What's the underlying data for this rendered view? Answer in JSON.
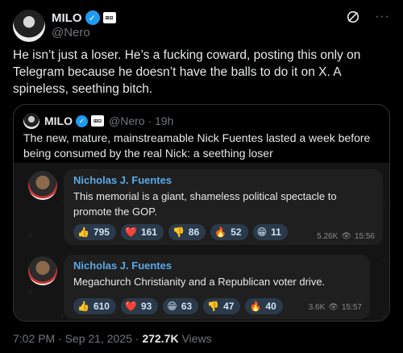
{
  "tweet": {
    "author_name": "MILO",
    "handle": "@Nero",
    "affiliate_badge": "⊞⊟",
    "text": "He isn’t just a loser. He’s a fucking coward, posting this only on Telegram because he doesn’t have the balls to do it on X. A spineless, seething bitch.",
    "timestamp": "7:02 PM · Sep 21, 2025 ·",
    "views_count": "272.7K",
    "views_label": "Views"
  },
  "quote": {
    "author_name": "MILO",
    "handle_time": "@Nero · 19h",
    "text": "The new, mature, mainstreamable Nick Fuentes lasted a week before being consumed by the real Nick: a seething loser"
  },
  "telegram": {
    "messages": [
      {
        "author": "Nicholas J. Fuentes",
        "text": "This memorial is a giant, shameless political spectacle to promote the GOP.",
        "reactions": [
          {
            "emoji": "👍",
            "count": "795"
          },
          {
            "emoji": "❤️",
            "count": "161"
          },
          {
            "emoji": "👎",
            "count": "86"
          },
          {
            "emoji": "🔥",
            "count": "52"
          },
          {
            "emoji": "😁",
            "count": "11"
          }
        ],
        "views": "5.26K",
        "time": "15:56"
      },
      {
        "author": "Nicholas J. Fuentes",
        "text": "Megachurch Christianity and a Republican voter drive.",
        "reactions": [
          {
            "emoji": "👍",
            "count": "610"
          },
          {
            "emoji": "❤️",
            "count": "93"
          },
          {
            "emoji": "😁",
            "count": "63"
          },
          {
            "emoji": "👎",
            "count": "47"
          },
          {
            "emoji": "🔥",
            "count": "40"
          }
        ],
        "views": "3.6K",
        "time": "15:57"
      }
    ]
  },
  "colors": {
    "verified": "#1d9bf0",
    "telegram_author": "#5aa8e6",
    "reaction_bg": "#2a3a4a"
  }
}
